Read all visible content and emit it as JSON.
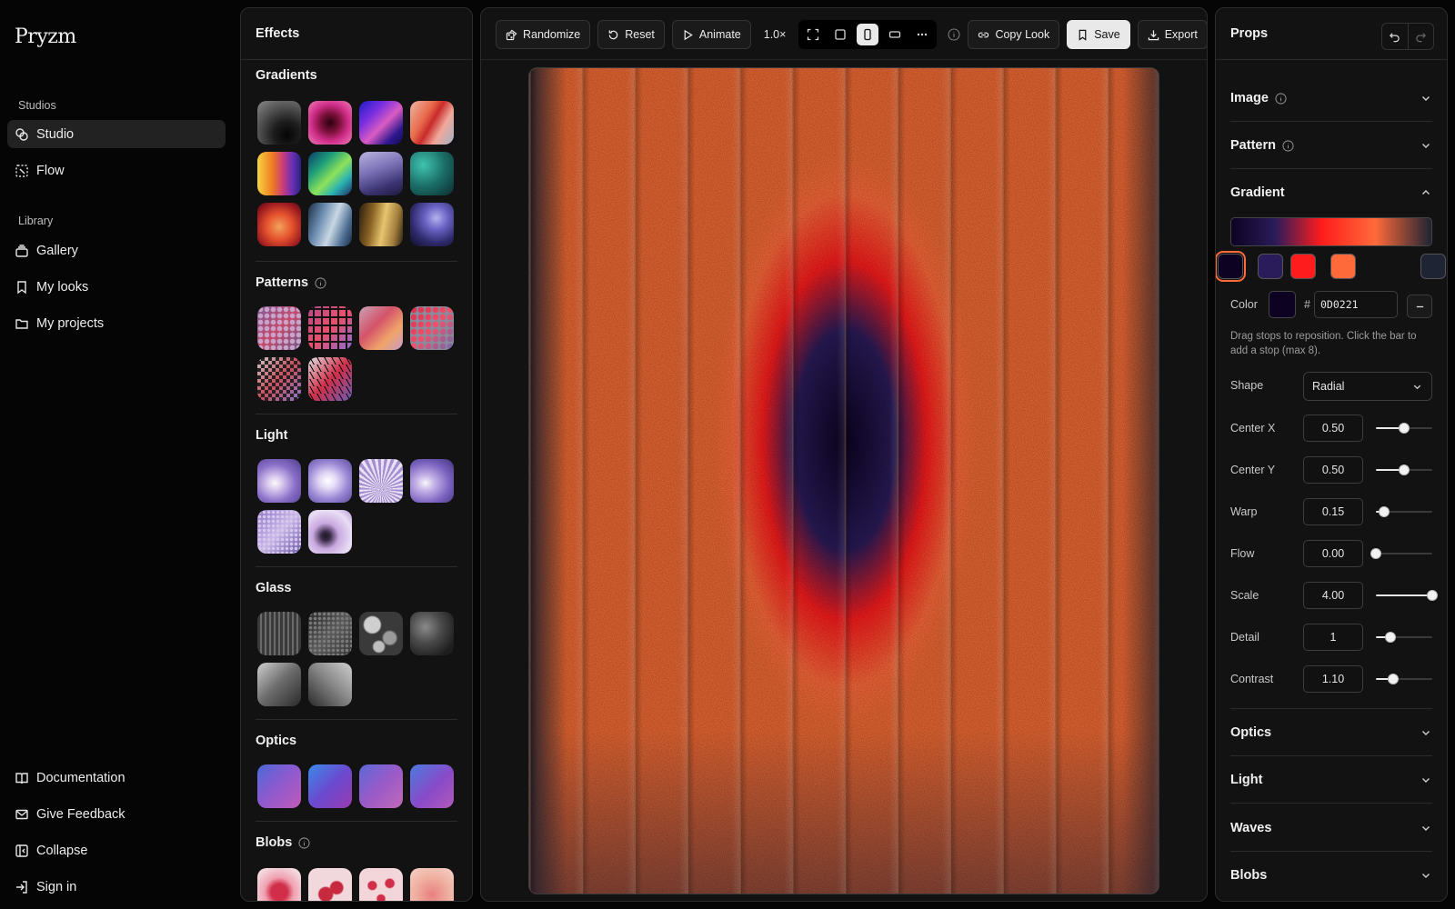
{
  "app": {
    "logo": "Pryzm"
  },
  "sidebar": {
    "studios_heading": "Studios",
    "studios": [
      {
        "label": "Studio",
        "icon": "studio-icon",
        "active": true
      },
      {
        "label": "Flow",
        "icon": "flow-icon",
        "active": false
      }
    ],
    "library_heading": "Library",
    "library": [
      {
        "label": "Gallery",
        "icon": "gallery-icon"
      },
      {
        "label": "My looks",
        "icon": "bookmark-icon"
      },
      {
        "label": "My projects",
        "icon": "folder-icon"
      }
    ],
    "footer": [
      {
        "label": "Documentation",
        "icon": "book-icon"
      },
      {
        "label": "Give Feedback",
        "icon": "mail-icon"
      },
      {
        "label": "Collapse",
        "icon": "collapse-icon"
      },
      {
        "label": "Sign in",
        "icon": "sign-in-icon"
      }
    ]
  },
  "effects": {
    "title": "Effects",
    "sections": [
      {
        "title": "Gradients",
        "info": false,
        "count": 12
      },
      {
        "title": "Patterns",
        "info": true,
        "count": 6
      },
      {
        "title": "Light",
        "info": false,
        "count": 6
      },
      {
        "title": "Glass",
        "info": false,
        "count": 6
      },
      {
        "title": "Optics",
        "info": false,
        "count": 4
      },
      {
        "title": "Blobs",
        "info": true,
        "count": 4
      }
    ]
  },
  "toolbar": {
    "randomize": "Randomize",
    "reset": "Reset",
    "animate": "Animate",
    "zoom": "1.0×",
    "view_modes": [
      "fullscreen",
      "square",
      "portrait",
      "landscape",
      "more"
    ],
    "active_view": "portrait",
    "copy_look": "Copy Look",
    "save": "Save",
    "export": "Export"
  },
  "props": {
    "title": "Props",
    "sections_top": [
      {
        "title": "Image",
        "info": true,
        "expanded": false
      },
      {
        "title": "Pattern",
        "info": true,
        "expanded": false
      }
    ],
    "gradient": {
      "title": "Gradient",
      "expanded": true,
      "stops": [
        "#0d0221",
        "#2a1b5a",
        "#ff1c1c",
        "#ff6a3a",
        "#1e2433"
      ],
      "selected_stop": 0,
      "color_label": "Color",
      "hash": "#",
      "hex_value": "0D0221",
      "hint": "Drag stops to reposition. Click the bar to add a stop (max 8).",
      "shape_label": "Shape",
      "shape_value": "Radial",
      "params": [
        {
          "label": "Center X",
          "value": "0.50",
          "level": 0.5
        },
        {
          "label": "Center Y",
          "value": "0.50",
          "level": 0.5
        },
        {
          "label": "Warp",
          "value": "0.15",
          "level": 0.15
        },
        {
          "label": "Flow",
          "value": "0.00",
          "level": 0.0
        },
        {
          "label": "Scale",
          "value": "4.00",
          "level": 1.0
        },
        {
          "label": "Detail",
          "value": "1",
          "level": 0.25
        },
        {
          "label": "Contrast",
          "value": "1.10",
          "level": 0.3
        }
      ]
    },
    "sections_bottom": [
      {
        "title": "Optics",
        "expanded": false
      },
      {
        "title": "Light",
        "expanded": false
      },
      {
        "title": "Waves",
        "expanded": false
      },
      {
        "title": "Blobs",
        "expanded": false
      }
    ]
  }
}
